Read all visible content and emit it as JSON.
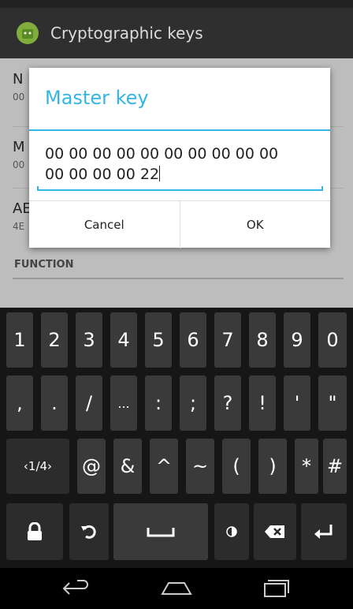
{
  "app": {
    "title": "Cryptographic keys"
  },
  "list": {
    "items": [
      {
        "title": "N",
        "subtitle": "00"
      },
      {
        "title": "M",
        "subtitle": "00"
      },
      {
        "title": "AE",
        "subtitle": "4E"
      }
    ],
    "section_header": "FUNCTION"
  },
  "dialog": {
    "title": "Master key",
    "value_line1": "00 00 00 00 00 00 00 00 00 00",
    "value_line2": "00 00 00 00 22",
    "cancel_label": "Cancel",
    "ok_label": "OK"
  },
  "keyboard": {
    "row1": [
      "1",
      "2",
      "3",
      "4",
      "5",
      "6",
      "7",
      "8",
      "9",
      "0"
    ],
    "row2": [
      ",",
      ".",
      "/",
      "...",
      ":",
      ";",
      "?",
      "!",
      "'",
      "\""
    ],
    "row3": [
      "‹1/4›",
      "@",
      "&",
      "^",
      "~",
      "(",
      ")",
      "*",
      "#"
    ],
    "row4_icons": [
      "lock-icon",
      "undo-icon",
      "space-key",
      "contrast-icon",
      "backspace-icon",
      "enter-icon"
    ]
  },
  "colors": {
    "accent": "#33b5e5",
    "actionbar": "#2f2f2f",
    "keyboard_bg": "#161616",
    "key": "#3a3a3a"
  }
}
